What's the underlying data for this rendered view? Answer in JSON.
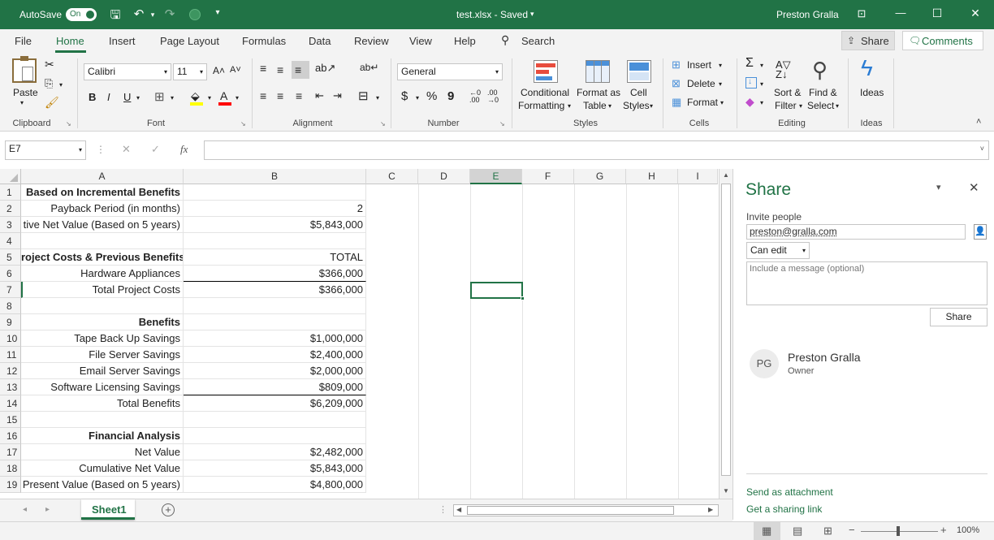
{
  "titlebar": {
    "autosave_label": "AutoSave",
    "autosave_toggle": "On",
    "file_title": "test.xlsx  -  Saved",
    "user_name": "Preston Gralla",
    "minimize": "—",
    "maximize": "☐",
    "close": "✕"
  },
  "tabs": [
    "File",
    "Home",
    "Insert",
    "Page Layout",
    "Formulas",
    "Data",
    "Review",
    "View",
    "Help"
  ],
  "search_label": "Search",
  "share_button": "Share",
  "comments_button": "Comments",
  "ribbon": {
    "clipboard": {
      "paste": "Paste",
      "label": "Clipboard"
    },
    "font": {
      "family": "Calibri",
      "size": "11",
      "bold": "B",
      "italic": "I",
      "underline": "U",
      "label": "Font"
    },
    "alignment": {
      "label": "Alignment"
    },
    "number": {
      "format": "General",
      "dollar": "$",
      "percent": "%",
      "comma": "9",
      "label": "Number"
    },
    "styles": {
      "conditional": "Conditional",
      "formatting": "Formatting",
      "format_as": "Format as",
      "table": "Table",
      "cell": "Cell",
      "cell_styles": "Styles",
      "label": "Styles"
    },
    "cells": {
      "insert": "Insert",
      "delete": "Delete",
      "format": "Format",
      "label": "Cells"
    },
    "editing": {
      "sort": "Sort &",
      "filter": "Filter",
      "find": "Find &",
      "select": "Select",
      "label": "Editing"
    },
    "ideas": {
      "button": "Ideas",
      "label": "Ideas"
    }
  },
  "formula_bar": {
    "name_box": "E7",
    "fx": "fx",
    "formula": ""
  },
  "columns": [
    "A",
    "B",
    "C",
    "D",
    "E",
    "F",
    "G",
    "H",
    "I"
  ],
  "rows": [
    {
      "n": "1",
      "a": "Based on Incremental Benefits",
      "b": "",
      "bold": true
    },
    {
      "n": "2",
      "a": "Payback Period (in months)",
      "b": "2"
    },
    {
      "n": "3",
      "a": "tive Net Value  (Based on 5 years)",
      "b": "$5,843,000"
    },
    {
      "n": "4",
      "a": "",
      "b": ""
    },
    {
      "n": "5",
      "a": "roject Costs & Previous Benefits",
      "b": "TOTAL",
      "bold": true
    },
    {
      "n": "6",
      "a": "Hardware Appliances",
      "b": "$366,000"
    },
    {
      "n": "7",
      "a": "Total Project Costs",
      "b": "$366,000"
    },
    {
      "n": "8",
      "a": "",
      "b": ""
    },
    {
      "n": "9",
      "a": "Benefits",
      "b": "",
      "bold": true
    },
    {
      "n": "10",
      "a": "Tape Back Up Savings",
      "b": "$1,000,000"
    },
    {
      "n": "11",
      "a": "File Server Savings",
      "b": "$2,400,000"
    },
    {
      "n": "12",
      "a": "Email Server Savings",
      "b": "$2,000,000"
    },
    {
      "n": "13",
      "a": "Software Licensing Savings",
      "b": "$809,000"
    },
    {
      "n": "14",
      "a": "Total Benefits",
      "b": "$6,209,000"
    },
    {
      "n": "15",
      "a": "",
      "b": ""
    },
    {
      "n": "16",
      "a": "Financial Analysis",
      "b": "",
      "bold": true
    },
    {
      "n": "17",
      "a": "Net Value",
      "b": "$2,482,000"
    },
    {
      "n": "18",
      "a": "Cumulative Net Value",
      "b": "$5,843,000"
    },
    {
      "n": "19",
      "a": "Present Value (Based on 5 years)",
      "b": "$4,800,000"
    }
  ],
  "sheet_tab": "Sheet1",
  "share_pane": {
    "title": "Share",
    "invite_label": "Invite people",
    "invite_value": "preston@gralla.com",
    "permission": "Can edit",
    "message_placeholder": "Include a message (optional)",
    "share_button": "Share",
    "owner_initials": "PG",
    "owner_name": "Preston Gralla",
    "owner_role": "Owner",
    "send_attachment": "Send as attachment",
    "sharing_link": "Get a sharing link"
  },
  "statusbar": {
    "zoom": "100%"
  },
  "colors": {
    "accent": "#217346",
    "ribbon_bg": "#f3f3f3"
  }
}
